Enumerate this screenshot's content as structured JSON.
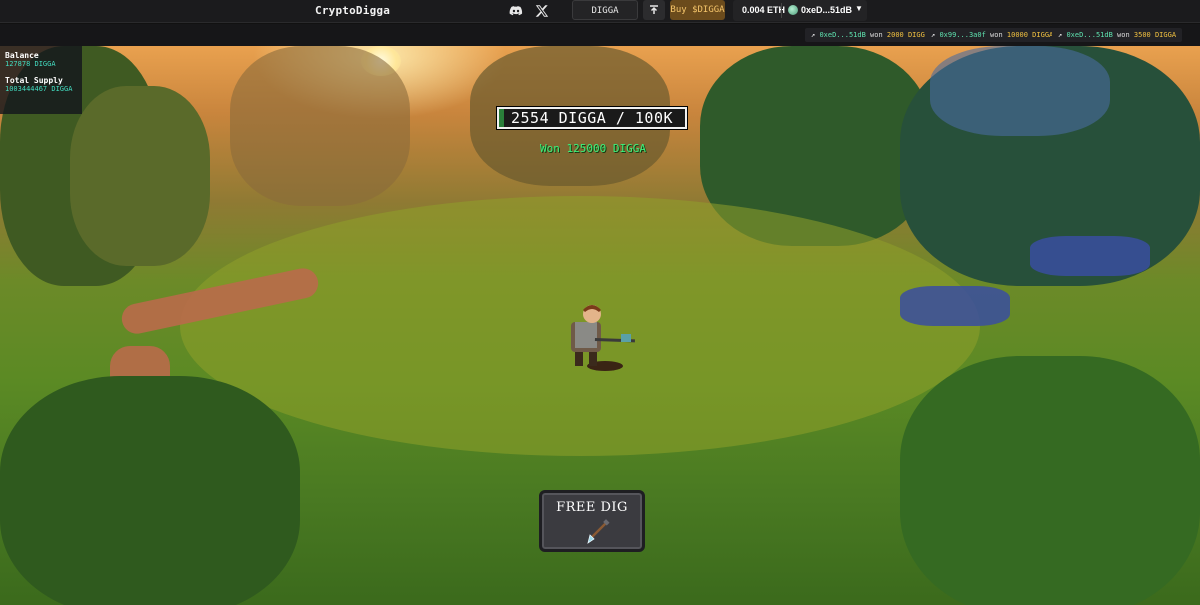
{
  "header": {
    "brand": "CryptoDigga",
    "icons": [
      "discord-icon",
      "x-icon"
    ],
    "contract_label": "DIGGA Contract",
    "upload_icon": "upload-icon",
    "buy_label": "Buy $DIGGA",
    "wallet": {
      "balance": "0.004 ETH",
      "address": "0xeD...51dB"
    }
  },
  "ticker": [
    {
      "address": "0xeD...51dB",
      "won": "won",
      "amount": "2000 DIGGA"
    },
    {
      "address": "0x99...3a0f",
      "won": "won",
      "amount": "10000 DIGGA"
    },
    {
      "address": "0xeD...51dB",
      "won": "won",
      "amount": "3500 DIGGA"
    }
  ],
  "stats": {
    "balance_label": "Balance",
    "balance_value": "127878 DIGGA",
    "supply_label": "Total Supply",
    "supply_value": "1003444467 DIGGA"
  },
  "progress": {
    "text": "2554 DIGGA / 100K",
    "fraction": 0.02554
  },
  "won_message": "Won 125000 DIGGA",
  "dig_button": {
    "label": "FREE DIG",
    "icon": "shovel-icon"
  },
  "colors": {
    "accent_green": "#43dcc0",
    "won_green": "#3bf07a",
    "gold": "#f0c040",
    "buy_bg": "#6b4b1c"
  }
}
